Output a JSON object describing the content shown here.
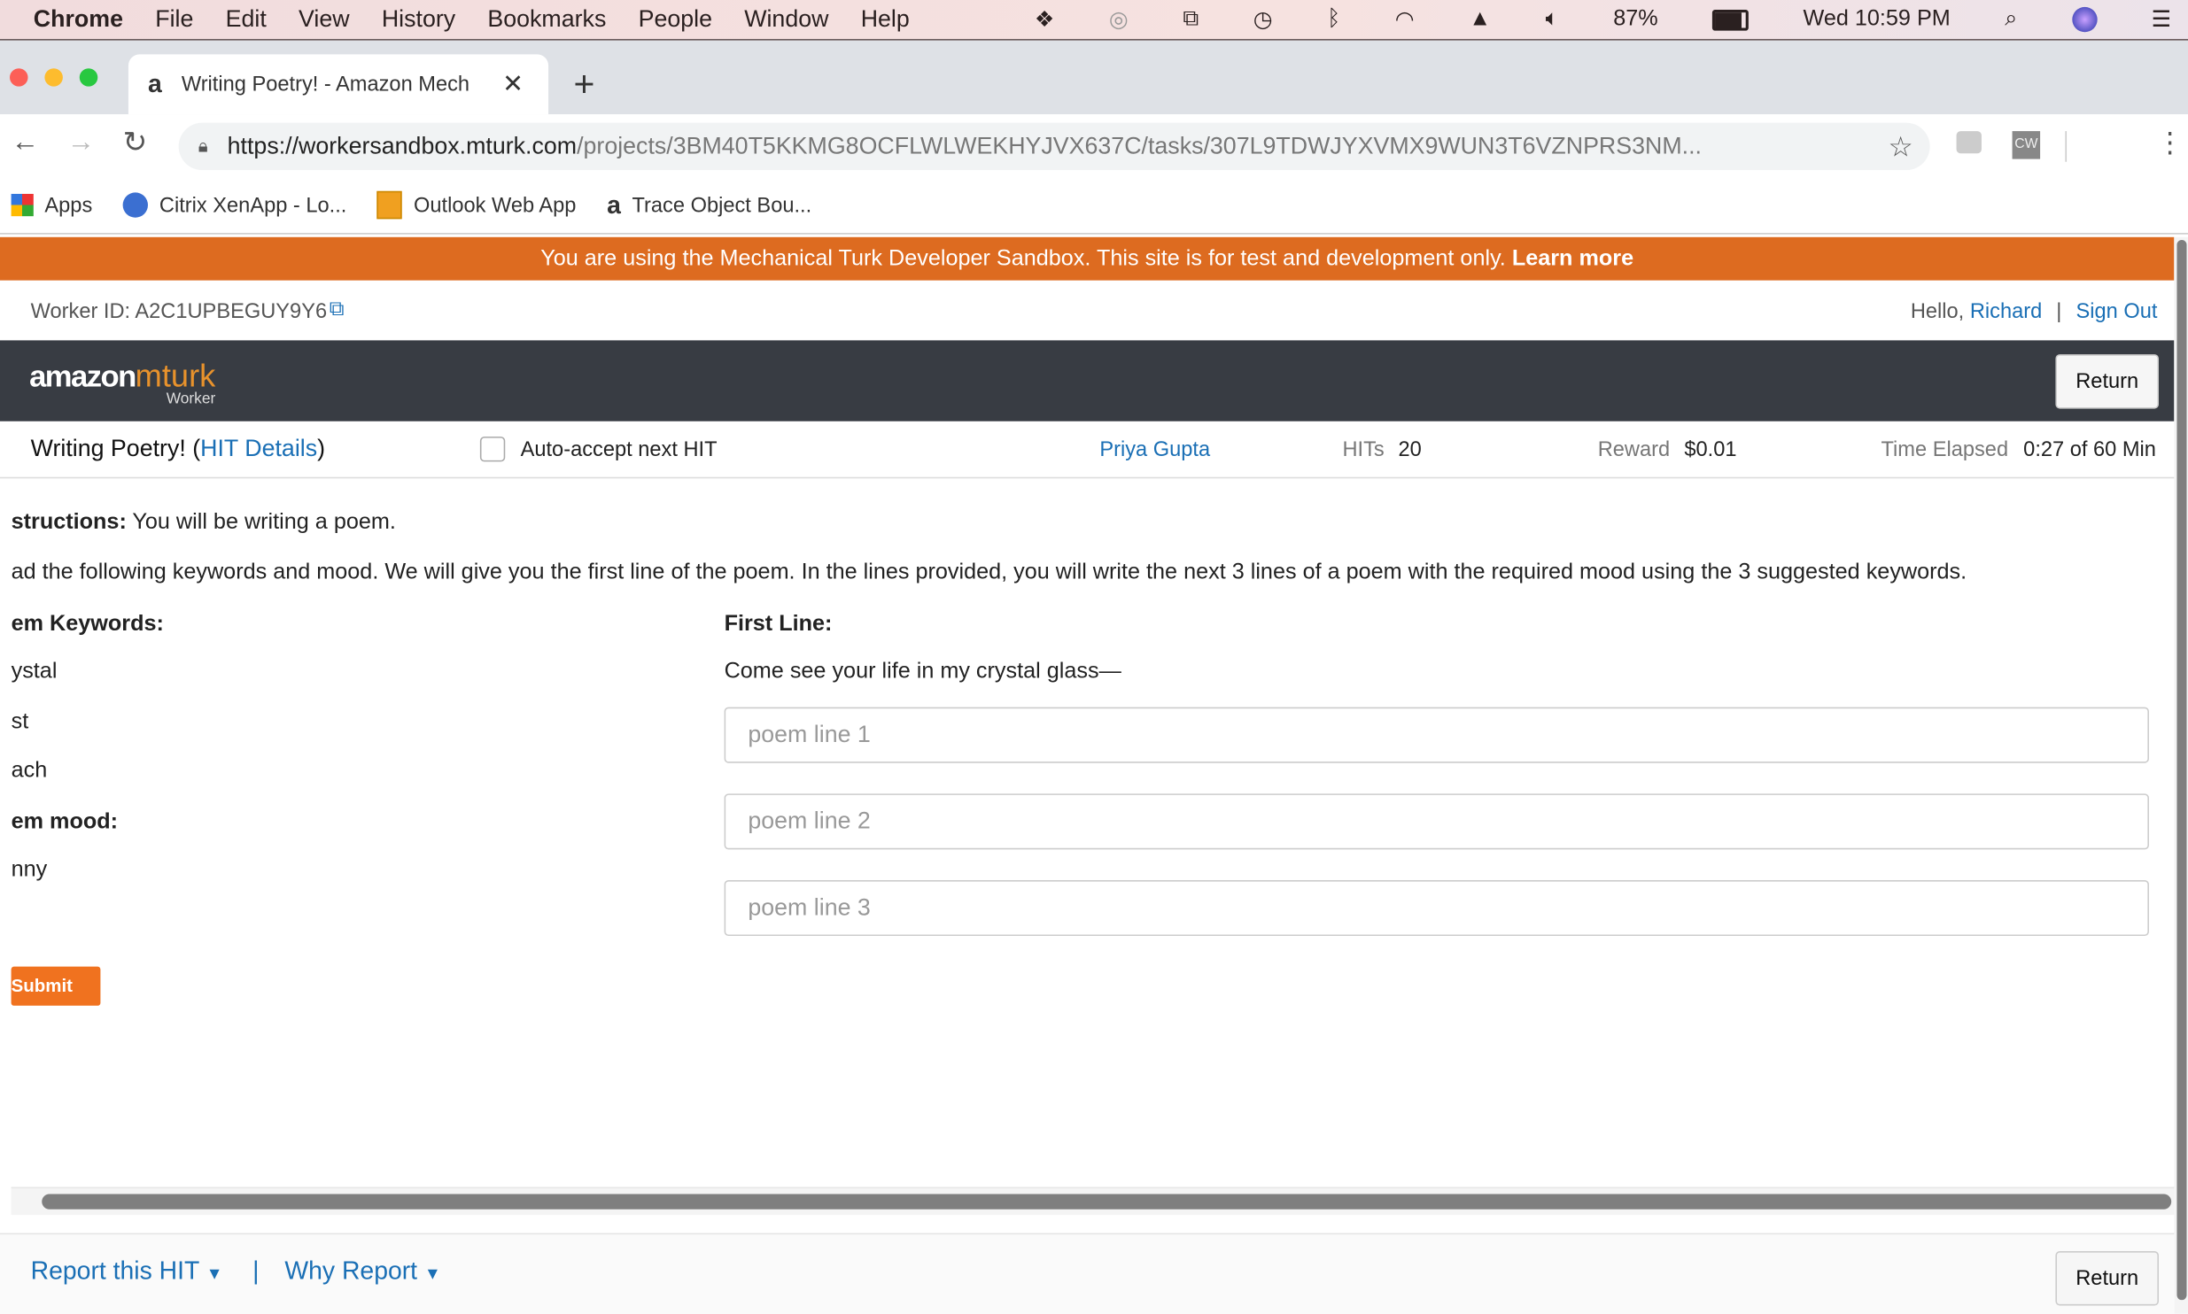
{
  "menubar": {
    "app": "Chrome",
    "items": [
      "File",
      "Edit",
      "View",
      "History",
      "Bookmarks",
      "People",
      "Window",
      "Help"
    ],
    "battery": "87%",
    "clock": "Wed 10:59 PM"
  },
  "browser": {
    "tab_title": "Writing Poetry! - Amazon Mech",
    "url_host": "https://workersandbox.mturk.com",
    "url_path": "/projects/3BM40T5KKMG8OCFLWLWEKHYJVX637C/tasks/307L9TDWJYXVMX9WUN3T6VZNPRS3NM...",
    "ext_label": "CW",
    "bookmarks": [
      "Apps",
      "Citrix XenApp - Lo...",
      "Outlook Web App",
      "Trace Object Bou..."
    ]
  },
  "banner": {
    "text": "You are using the Mechanical Turk Developer Sandbox. This site is for test and development only. ",
    "link": "Learn more",
    "color": "#dd6b20"
  },
  "account": {
    "worker_id": "Worker ID: A2C1UPBEGUY9Y6",
    "hello": "Hello, ",
    "name": "Richard",
    "sep": "|",
    "sign_out": "Sign Out"
  },
  "header": {
    "logo_amazon": "amazon",
    "logo_mturk": "mturk",
    "logo_sub": "Worker",
    "return": "Return"
  },
  "hit": {
    "title": "Writing Poetry! (",
    "details": "HIT Details",
    "close": ")",
    "auto_accept": "Auto-accept next HIT",
    "requester": "Priya Gupta",
    "hits_label": "HITs",
    "hits": "20",
    "reward_label": "Reward",
    "reward": "$0.01",
    "time_label": "Time Elapsed",
    "time": "0:27 of 60 Min"
  },
  "task": {
    "instr_label": "structions:",
    "instr": " You will be writing a poem.",
    "instr2": "ad the following keywords and mood. We will give you the first line of the poem. In the lines provided, you will write the next 3 lines of a poem with the required mood using the 3 suggested keywords.",
    "keywords_label": "em Keywords:",
    "keywords": [
      "ystal",
      "st",
      "ach"
    ],
    "mood_label": "em mood:",
    "mood": "nny",
    "first_line_label": "First Line:",
    "first_line": "Come see your life in my crystal glass—",
    "placeholders": [
      "poem line 1",
      "poem line 2",
      "poem line 3"
    ],
    "submit": "Submit"
  },
  "footer": {
    "report": "Report this HIT",
    "sep": "|",
    "why": "Why Report",
    "return": "Return"
  }
}
